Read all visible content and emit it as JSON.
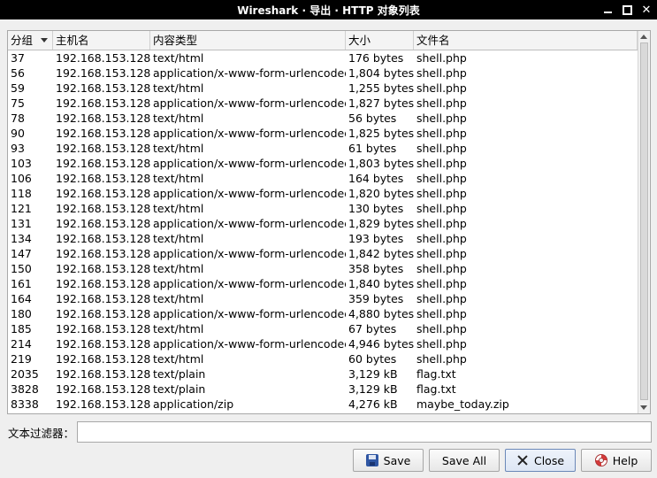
{
  "window": {
    "title": "Wireshark · 导出 · HTTP 对象列表"
  },
  "table": {
    "columns": [
      "分组",
      "主机名",
      "内容类型",
      "大小",
      "文件名"
    ],
    "rows": [
      [
        "37",
        "192.168.153.128",
        "text/html",
        "176 bytes",
        "shell.php"
      ],
      [
        "56",
        "192.168.153.128",
        "application/x-www-form-urlencoded",
        "1,804 bytes",
        "shell.php"
      ],
      [
        "59",
        "192.168.153.128",
        "text/html",
        "1,255 bytes",
        "shell.php"
      ],
      [
        "75",
        "192.168.153.128",
        "application/x-www-form-urlencoded",
        "1,827 bytes",
        "shell.php"
      ],
      [
        "78",
        "192.168.153.128",
        "text/html",
        "56 bytes",
        "shell.php"
      ],
      [
        "90",
        "192.168.153.128",
        "application/x-www-form-urlencoded",
        "1,825 bytes",
        "shell.php"
      ],
      [
        "93",
        "192.168.153.128",
        "text/html",
        "61 bytes",
        "shell.php"
      ],
      [
        "103",
        "192.168.153.128",
        "application/x-www-form-urlencoded",
        "1,803 bytes",
        "shell.php"
      ],
      [
        "106",
        "192.168.153.128",
        "text/html",
        "164 bytes",
        "shell.php"
      ],
      [
        "118",
        "192.168.153.128",
        "application/x-www-form-urlencoded",
        "1,820 bytes",
        "shell.php"
      ],
      [
        "121",
        "192.168.153.128",
        "text/html",
        "130 bytes",
        "shell.php"
      ],
      [
        "131",
        "192.168.153.128",
        "application/x-www-form-urlencoded",
        "1,829 bytes",
        "shell.php"
      ],
      [
        "134",
        "192.168.153.128",
        "text/html",
        "193 bytes",
        "shell.php"
      ],
      [
        "147",
        "192.168.153.128",
        "application/x-www-form-urlencoded",
        "1,842 bytes",
        "shell.php"
      ],
      [
        "150",
        "192.168.153.128",
        "text/html",
        "358 bytes",
        "shell.php"
      ],
      [
        "161",
        "192.168.153.128",
        "application/x-www-form-urlencoded",
        "1,840 bytes",
        "shell.php"
      ],
      [
        "164",
        "192.168.153.128",
        "text/html",
        "359 bytes",
        "shell.php"
      ],
      [
        "180",
        "192.168.153.128",
        "application/x-www-form-urlencoded",
        "4,880 bytes",
        "shell.php"
      ],
      [
        "185",
        "192.168.153.128",
        "text/html",
        "67 bytes",
        "shell.php"
      ],
      [
        "214",
        "192.168.153.128",
        "application/x-www-form-urlencoded",
        "4,946 bytes",
        "shell.php"
      ],
      [
        "219",
        "192.168.153.128",
        "text/html",
        "60 bytes",
        "shell.php"
      ],
      [
        "2035",
        "192.168.153.128",
        "text/plain",
        "3,129 kB",
        "flag.txt"
      ],
      [
        "3828",
        "192.168.153.128",
        "text/plain",
        "3,129 kB",
        "flag.txt"
      ],
      [
        "8338",
        "192.168.153.128",
        "application/zip",
        "4,276 kB",
        "maybe_today.zip"
      ]
    ]
  },
  "filter": {
    "label": "文本过滤器：",
    "value": ""
  },
  "buttons": {
    "save": "Save",
    "save_all": "Save All",
    "close": "Close",
    "help": "Help"
  }
}
